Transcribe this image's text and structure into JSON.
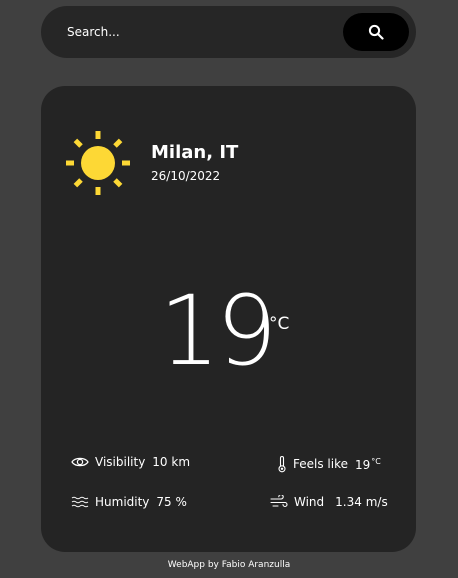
{
  "search": {
    "placeholder": "Search...",
    "icon": "search-icon"
  },
  "weather": {
    "icon": "sun-icon",
    "city": "Milan, IT",
    "date": "26/10/2022",
    "temperature": "19",
    "temperature_unit": "°C",
    "details": {
      "visibility": {
        "icon": "eye-icon",
        "label": "Visibility",
        "value": "10 km"
      },
      "feels_like": {
        "icon": "thermometer-icon",
        "label": "Feels like",
        "value": "19",
        "unit": "°C"
      },
      "humidity": {
        "icon": "humidity-waves-icon",
        "label": "Humidity",
        "value": "75 %"
      },
      "wind": {
        "icon": "wind-icon",
        "label": "Wind",
        "value": "1.34 m/s"
      }
    }
  },
  "footer": {
    "text": "WebApp by Fabio Aranzulla"
  },
  "colors": {
    "background": "#404040",
    "card": "#242424",
    "search_bar": "#262626",
    "search_button": "#000000",
    "sun": "#fdd835",
    "text": "#ffffff"
  }
}
